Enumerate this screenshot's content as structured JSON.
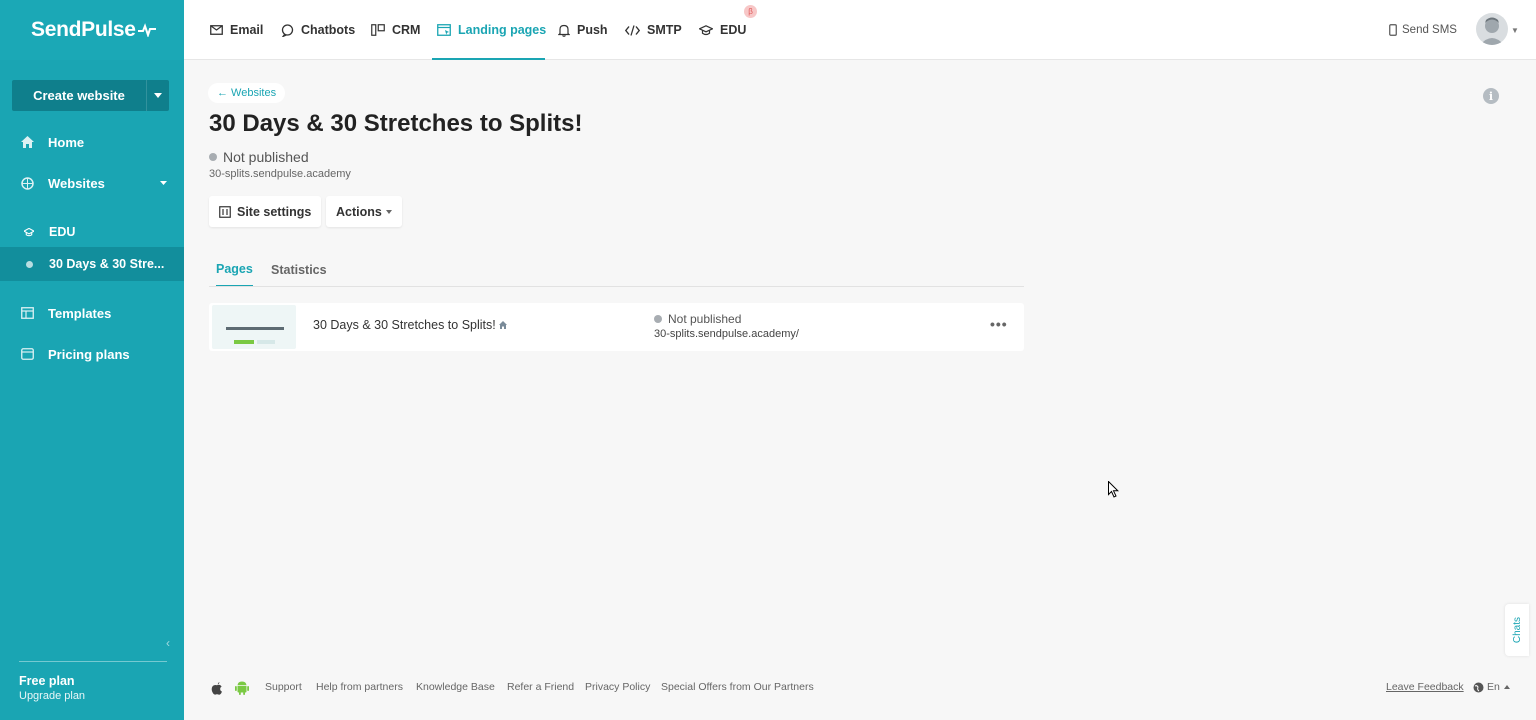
{
  "brand": {
    "name": "SendPulse"
  },
  "sidebar": {
    "create_label": "Create website",
    "items": [
      {
        "label": "Home",
        "icon": "home-icon"
      },
      {
        "label": "Websites",
        "icon": "globe-icon"
      }
    ],
    "sub_items": [
      {
        "label": "EDU",
        "icon": "edu-icon"
      },
      {
        "label": "30 Days & 30 Stre...",
        "icon": "dot-icon",
        "active": true
      }
    ],
    "bottom_items": [
      {
        "label": "Templates",
        "icon": "templates-icon"
      },
      {
        "label": "Pricing plans",
        "icon": "pricing-icon"
      }
    ],
    "plan": "Free plan",
    "upgrade": "Upgrade plan"
  },
  "topnav": {
    "items": [
      {
        "label": "Email",
        "icon": "email-icon"
      },
      {
        "label": "Chatbots",
        "icon": "chatbots-icon"
      },
      {
        "label": "CRM",
        "icon": "crm-icon"
      },
      {
        "label": "Landing pages",
        "icon": "landing-icon",
        "active": true
      },
      {
        "label": "Push",
        "icon": "bell-icon"
      },
      {
        "label": "SMTP",
        "icon": "code-icon"
      },
      {
        "label": "EDU",
        "icon": "edu-icon"
      }
    ],
    "beta_badge": "β",
    "send_sms": "Send SMS"
  },
  "site": {
    "back_link": "← Websites",
    "title": "30 Days & 30 Stretches to Splits!",
    "status": "Not published",
    "domain": "30-splits.sendpulse.academy",
    "settings_label": "Site settings",
    "actions_label": "Actions"
  },
  "tabs": [
    {
      "label": "Pages",
      "active": true
    },
    {
      "label": "Statistics"
    }
  ],
  "pages": [
    {
      "name": "30 Days & 30 Stretches to Splits!",
      "status": "Not published",
      "url": "30-splits.sendpulse.academy/"
    }
  ],
  "footer": {
    "links": [
      "Support",
      "Help from partners",
      "Knowledge Base",
      "Refer a Friend",
      "Privacy Policy",
      "Special Offers from Our Partners"
    ],
    "feedback": "Leave Feedback",
    "language": "En"
  },
  "chats_label": "Chats",
  "colors": {
    "accent": "#1aa5b3",
    "sidebar": "#1aa5b3",
    "sidebar_active": "#128e9c"
  }
}
